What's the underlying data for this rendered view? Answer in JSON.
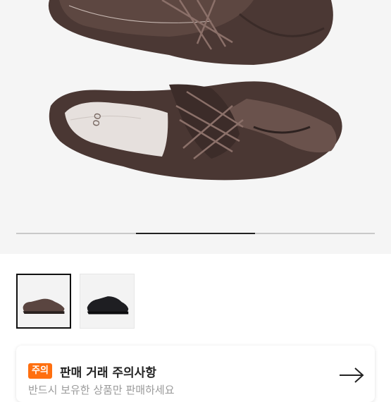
{
  "gallery": {
    "current_index": 2,
    "total": 3,
    "thumbnails": [
      {
        "name": "brown-shoe"
      },
      {
        "name": "black-shoe"
      }
    ]
  },
  "notice": {
    "badge": "주의",
    "title": "판매 거래 주의사항",
    "subtitle": "반드시 보유한 상품만 판매하세요"
  },
  "colors": {
    "accent": "#ff6f0f",
    "shoe_brown": "#5a4540"
  }
}
